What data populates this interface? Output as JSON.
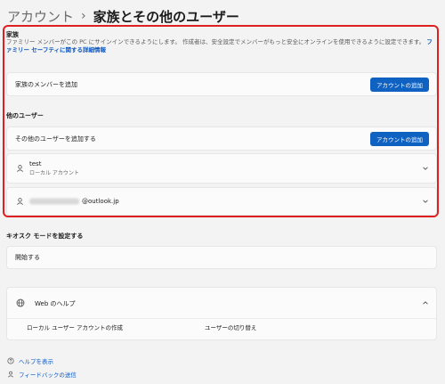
{
  "breadcrumb": {
    "parent": "アカウント",
    "separator": "›",
    "current": "家族とその他のユーザー"
  },
  "family": {
    "heading": "家族",
    "description": "ファミリー メンバーがこの PC にサインインできるようにします。 作成者は、安全設定でメンバーがもっと安全にオンラインを使用できるように設定できます。",
    "description_link": "ファミリー セーフティに関する詳細情報",
    "add_member_label": "家族のメンバーを追加",
    "add_account_button": "アカウントの追加"
  },
  "other_users": {
    "heading": "他のユーザー",
    "add_other_label": "その他のユーザーを追加する",
    "add_account_button": "アカウントの追加",
    "users": [
      {
        "name": "test",
        "type": "ローカル アカウント"
      },
      {
        "email_suffix": "@outlook.jp"
      }
    ]
  },
  "kiosk": {
    "heading": "キオスク モードを設定する",
    "start_label": "開始する"
  },
  "web_help": {
    "title": "Web のヘルプ",
    "links": [
      "ローカル ユーザー アカウントの作成",
      "ユーザーの切り替え"
    ]
  },
  "footer": {
    "help": "ヘルプを表示",
    "feedback": "フィードバックの送信"
  },
  "colors": {
    "accent": "#0f61c2",
    "highlight_border": "#e02020",
    "link": "#0b57c2"
  }
}
